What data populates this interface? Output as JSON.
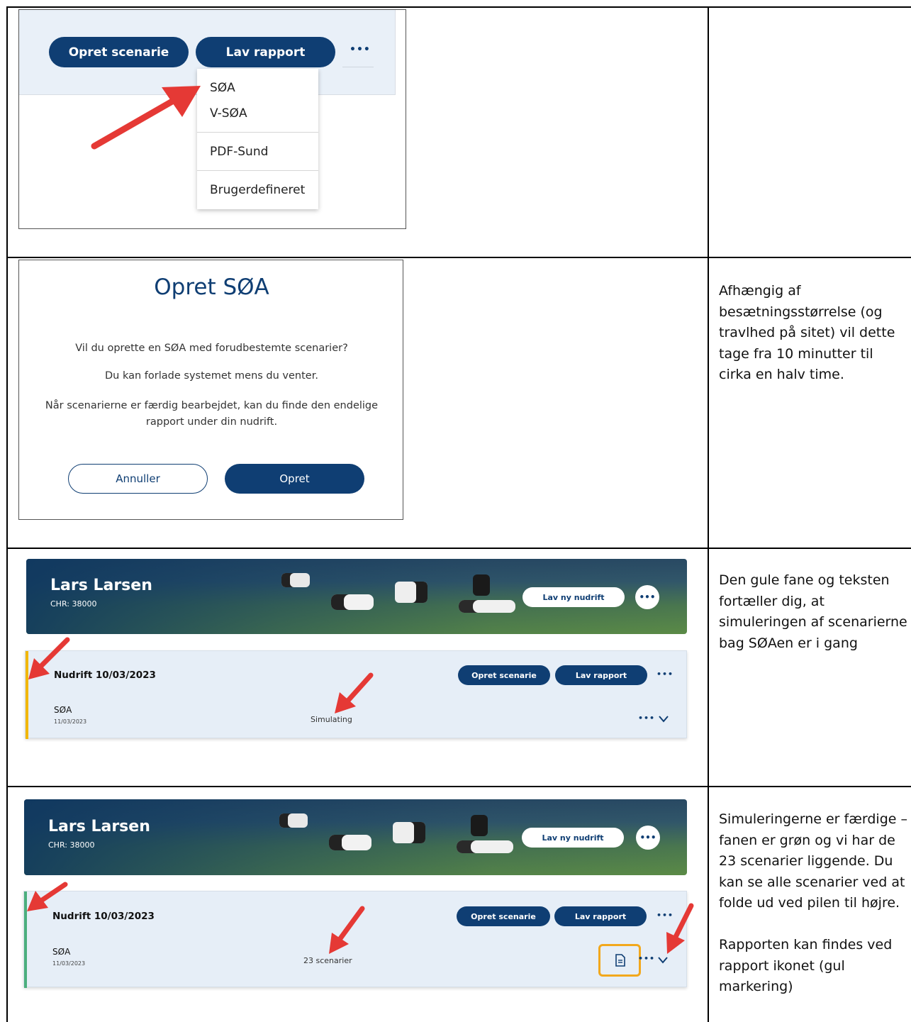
{
  "row1": {
    "buttons": {
      "create_scenario": "Opret scenarie",
      "make_report": "Lav rapport",
      "more": "•••"
    },
    "menu": {
      "items": [
        "SØA",
        "V-SØA",
        "PDF-Sund",
        "Brugerdefineret"
      ]
    },
    "note": ""
  },
  "row2": {
    "dialog": {
      "title": "Opret SØA",
      "line1": "Vil du oprette en SØA med forudbestemte scenarier?",
      "line2": "Du kan forlade systemet mens du venter.",
      "line3": "Når scenarierne er færdig bearbejdet, kan du finde den endelige rapport under din nudrift.",
      "cancel": "Annuller",
      "confirm": "Opret"
    },
    "note": "Afhængig af besætningsstørrelse (og travlhed på sitet) vil dette tage fra 10 minutter til cirka en halv time."
  },
  "row3": {
    "farm": {
      "name": "Lars Larsen",
      "chr": "CHR: 38000",
      "new_button": "Lav ny nudrift",
      "more": "•••"
    },
    "card": {
      "title": "Nudrift 10/03/2023",
      "create_scenario": "Opret scenarie",
      "make_report": "Lav rapport",
      "more": "•••",
      "soa": "SØA",
      "date": "11/03/2023",
      "status": "Simulating",
      "row_more": "•••",
      "accent": "#f2b705"
    },
    "note": "Den gule fane og teksten fortæller dig, at simuleringen af scenarierne bag SØAen er i gang"
  },
  "row4": {
    "farm": {
      "name": "Lars Larsen",
      "chr": "CHR: 38000",
      "new_button": "Lav ny nudrift",
      "more": "•••"
    },
    "card": {
      "title": "Nudrift 10/03/2023",
      "create_scenario": "Opret scenarie",
      "make_report": "Lav rapport",
      "more": "•••",
      "soa": "SØA",
      "date": "11/03/2023",
      "status": "23 scenarier",
      "row_more": "•••",
      "accent": "#4caf7d",
      "highlight": "#f2a81d"
    },
    "note": "Simuleringerne er færdige – fanen er grøn og vi har de 23 scenarier liggende. Du kan se alle scenarier ved at folde ud ved pilen til højre.\n\nRapporten kan findes ved rapport ikonet (gul markering)"
  },
  "colors": {
    "navy": "#0f3e73",
    "arrow": "#e53935"
  }
}
